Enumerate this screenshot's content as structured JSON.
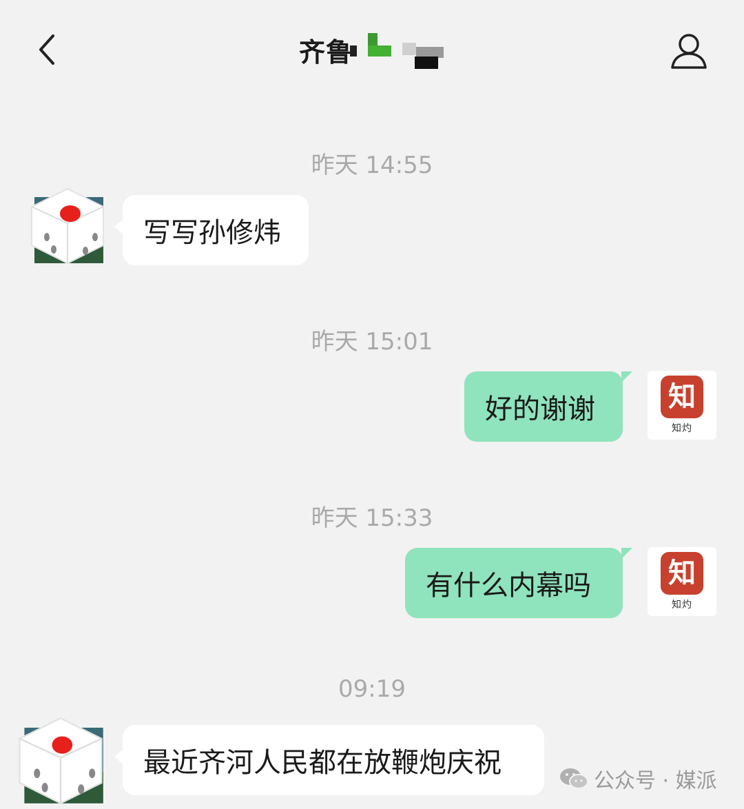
{
  "header": {
    "title": "齐鲁",
    "back_icon": "chevron-left-icon",
    "profile_icon": "person-icon"
  },
  "messages": [
    {
      "time": "昨天 14:55",
      "side": "left",
      "text": "写写孙修炜"
    },
    {
      "time": "昨天 15:01",
      "side": "right",
      "text": "好的谢谢"
    },
    {
      "time": "昨天 15:33",
      "side": "right",
      "text": "有什么内幕吗"
    },
    {
      "time": "09:19",
      "side": "left",
      "text": "最近齐河人民都在放鞭炮庆祝"
    }
  ],
  "my_avatar": {
    "glyph": "知",
    "caption": "知灼"
  },
  "watermark": {
    "text": "公众号 · 媒派"
  },
  "colors": {
    "background": "#f2f2f2",
    "my_bubble": "#8fe3bd",
    "other_bubble": "#ffffff",
    "seal_red": "#c7412e"
  }
}
